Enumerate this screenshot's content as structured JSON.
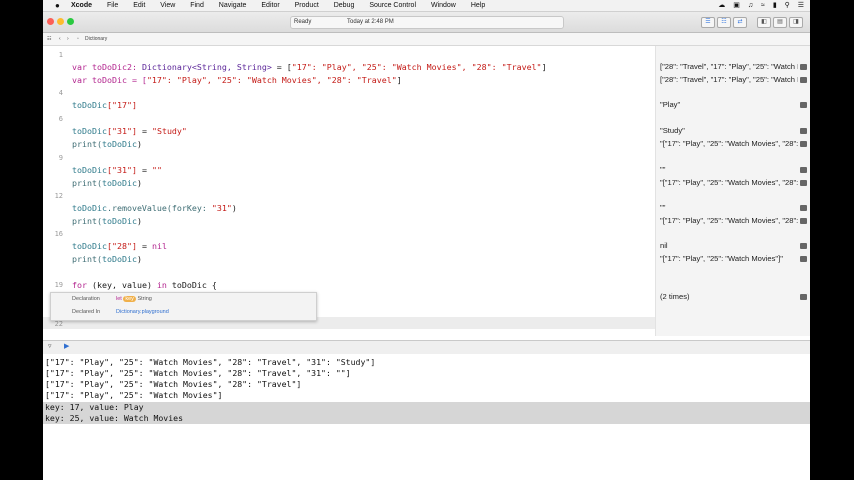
{
  "menubar": {
    "apple": "",
    "items": [
      "Xcode",
      "File",
      "Edit",
      "View",
      "Find",
      "Navigate",
      "Editor",
      "Product",
      "Debug",
      "Source Control",
      "Window",
      "Help"
    ]
  },
  "toolbar": {
    "status": "Ready",
    "time": "Today at 2:48 PM"
  },
  "jumpbar": {
    "file": "Dictionary"
  },
  "editor": {
    "line_numbers": [
      "1",
      "4",
      "6",
      "9",
      "12",
      "16",
      "19",
      "22"
    ],
    "code": {
      "l1_a": "var toDoDic2: ",
      "l1_type": "Dictionary<String, String>",
      "l1_b": " = [",
      "l1_lit": "\"17\": \"Play\", \"25\": \"Watch Movies\", \"28\": \"Travel\"",
      "l1_c": "]",
      "l2_a": "var toDoDic = [",
      "l2_lit": "\"17\": \"Play\", \"25\": \"Watch Movies\", \"28\": \"Travel\"",
      "l2_b": "]",
      "l3_var": "toDoDic",
      "l3_key": "[\"17\"]",
      "l4_var": "toDoDic",
      "l4_key": "[\"31\"]",
      "l4_b": " = ",
      "l4_val": "\"Study\"",
      "p_fn": "print(",
      "p_var": "toDoDic",
      "p_end": ")",
      "l6_var": "toDoDic",
      "l6_key": "[\"31\"]",
      "l6_b": " = ",
      "l6_val": "\"\"",
      "l8_var": "toDoDic",
      "l8_call": ".removeValue(forKey: ",
      "l8_val": "\"31\"",
      "l8_end": ")",
      "l10_var": "toDoDic",
      "l10_key": "[\"28\"]",
      "l10_b": " = ",
      "l10_nil": "nil",
      "l12_for": "for",
      "l12_mid": " (key, value) ",
      "l12_in": "in",
      "l12_end": " toDoDic {"
    }
  },
  "popup": {
    "declaration_label": "Declaration",
    "declaration_kw": "let",
    "declaration_name": "key",
    "declaration_type": "String",
    "declared_in_label": "Declared In",
    "declared_in_file": "Dictionary.playground"
  },
  "results": [
    "[\"28\": \"Travel\", \"17\": \"Play\", \"25\": \"Watch Movies\"]",
    "[\"28\": \"Travel\", \"17\": \"Play\", \"25\": \"Watch Movies\"]",
    "\"Play\"",
    "\"Study\"",
    "\"[\"17\": \"Play\", \"25\": \"Watch Movies\", \"28\": \"Travel\", \"31\": \"Study\"]\"",
    "\"\"",
    "\"[\"17\": \"Play\", \"25\": \"Watch Movies\", \"28\": \"Travel\", \"31\": \"\"]\"",
    "\"\"",
    "\"[\"17\": \"Play\", \"25\": \"Watch Movies\", \"28\": \"Travel\"]\"",
    "nil",
    "\"[\"17\": \"Play\", \"25\": \"Watch Movies\"]\"",
    "(2 times)"
  ],
  "console": {
    "lines": [
      "[\"17\": \"Play\", \"25\": \"Watch Movies\", \"28\": \"Travel\", \"31\": \"Study\"]",
      "[\"17\": \"Play\", \"25\": \"Watch Movies\", \"28\": \"Travel\", \"31\": \"\"]",
      "[\"17\": \"Play\", \"25\": \"Watch Movies\", \"28\": \"Travel\"]",
      "[\"17\": \"Play\", \"25\": \"Watch Movies\"]",
      "key: 17, value: Play",
      "key: 25, value: Watch Movies"
    ]
  }
}
